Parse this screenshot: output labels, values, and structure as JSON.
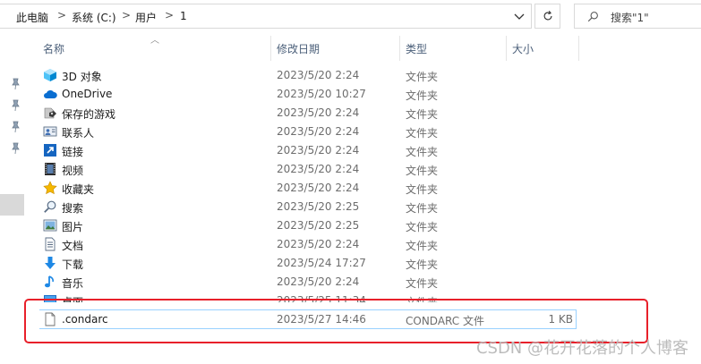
{
  "address": {
    "crumbs": [
      "此电脑",
      "系统 (C:)",
      "用户",
      "1"
    ],
    "separator": ">",
    "search_placeholder": "搜索\"1\""
  },
  "columns": {
    "name": "名称",
    "modified": "修改日期",
    "type": "类型",
    "size": "大小"
  },
  "files": [
    {
      "name": "3D 对象",
      "date": "2023/5/20 2:24",
      "type": "文件夹",
      "size": "",
      "icon": "3d-objects-icon"
    },
    {
      "name": "OneDrive",
      "date": "2023/5/20 10:27",
      "type": "文件夹",
      "size": "",
      "icon": "onedrive-cloud-icon"
    },
    {
      "name": "保存的游戏",
      "date": "2023/5/20 2:24",
      "type": "文件夹",
      "size": "",
      "icon": "saved-games-icon"
    },
    {
      "name": "联系人",
      "date": "2023/5/20 2:24",
      "type": "文件夹",
      "size": "",
      "icon": "contacts-icon"
    },
    {
      "name": "链接",
      "date": "2023/5/20 2:24",
      "type": "文件夹",
      "size": "",
      "icon": "links-icon"
    },
    {
      "name": "视频",
      "date": "2023/5/20 2:24",
      "type": "文件夹",
      "size": "",
      "icon": "videos-icon"
    },
    {
      "name": "收藏夹",
      "date": "2023/5/20 2:24",
      "type": "文件夹",
      "size": "",
      "icon": "favorites-star-icon"
    },
    {
      "name": "搜索",
      "date": "2023/5/20 2:25",
      "type": "文件夹",
      "size": "",
      "icon": "searches-icon"
    },
    {
      "name": "图片",
      "date": "2023/5/20 2:25",
      "type": "文件夹",
      "size": "",
      "icon": "pictures-icon"
    },
    {
      "name": "文档",
      "date": "2023/5/20 2:24",
      "type": "文件夹",
      "size": "",
      "icon": "documents-icon"
    },
    {
      "name": "下载",
      "date": "2023/5/24 17:27",
      "type": "文件夹",
      "size": "",
      "icon": "downloads-arrow-icon"
    },
    {
      "name": "音乐",
      "date": "2023/5/20 2:24",
      "type": "文件夹",
      "size": "",
      "icon": "music-note-icon"
    },
    {
      "name": "桌面",
      "date": "2023/5/25 11:34",
      "type": "文件夹",
      "size": "",
      "icon": "desktop-icon"
    },
    {
      "name": ".condarc",
      "date": "2023/5/27 14:46",
      "type": "CONDARC 文件",
      "size": "1 KB",
      "icon": "file-icon"
    }
  ],
  "watermark": "CSDN @花开花落的个人博客",
  "colors": {
    "highlight_border": "#e8202a",
    "selection": "#cce8ff",
    "header_text": "#4c607a"
  }
}
